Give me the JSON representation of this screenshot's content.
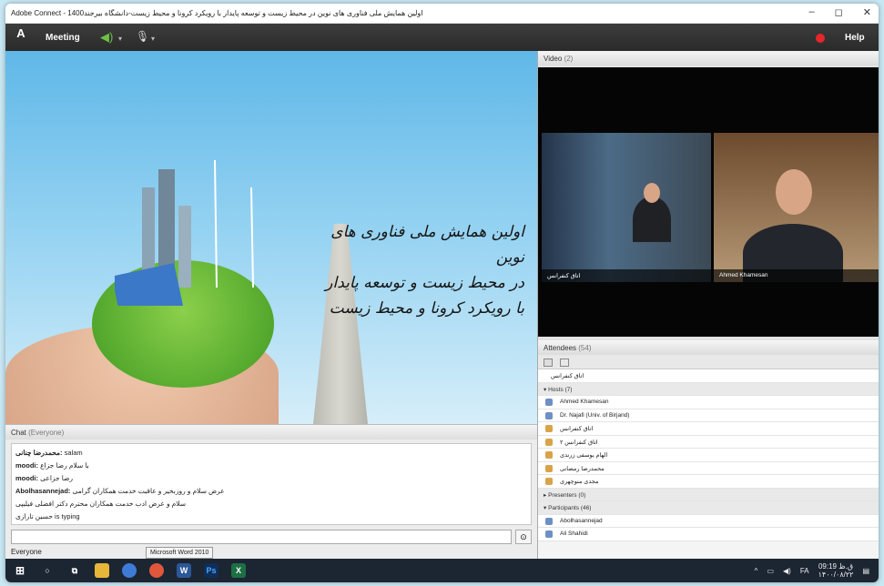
{
  "window": {
    "title": "اولین همایش ملی فناوری های نوین در محیط زیست و توسعه پایدار با رویکرد کرونا و محیط زیست-دانشگاه بیرجند1400 - Adobe Connect",
    "controls": [
      "–",
      "◻",
      "✕"
    ]
  },
  "menubar": {
    "meeting_label": "Meeting",
    "help_label": "Help",
    "logo_text": "A"
  },
  "slide": {
    "title_lines": [
      "اولین همایش ملی فناوری های نوین",
      "در محیط زیست و توسعه پایدار",
      "با رویکرد کرونا و محیط زیست"
    ]
  },
  "chat": {
    "title": "Chat",
    "scope": "(Everyone)",
    "messages": [
      {
        "sender": "محمدرضا چنانی:",
        "text": "salam"
      },
      {
        "sender": "moodi:",
        "text": "با سلام رضا جزاع"
      },
      {
        "sender": "moodi:",
        "text": "رضا جزاعی"
      },
      {
        "sender": "Abolhasannejad:",
        "text": "عرض سلام و روزبخیر و عاقبت خدمت همکاران گرامی"
      },
      {
        "sender": "",
        "text": "سلام و عرض ادب خدمت همکاران محترم دکتر افضلی فیلیپی"
      },
      {
        "sender": "",
        "text": "حسین تارازی is typing"
      }
    ],
    "recipient": "Everyone"
  },
  "video": {
    "title": "Video",
    "count": "(2)",
    "feeds": [
      {
        "name": "اتاق کنفرانس"
      },
      {
        "name": "Ahmed Khamesan"
      }
    ]
  },
  "attendees": {
    "title": "Attendees",
    "count": "(54)",
    "me": "اتاق کنفرانس",
    "hosts_label": "Hosts (7)",
    "hosts": [
      "Ahmed Khamesan",
      "Dr. Najafi (Univ. of Birjand)",
      "اتاق کنفرانس",
      "اتاق کنفرانس ۲",
      "الهام یوسفی زرندی",
      "محمدرضا رمضانی",
      "مجدی منوچهری"
    ],
    "presenters_label": "Presenters (0)",
    "participants_label": "Participants (46)",
    "participants": [
      "Abolhasannejad",
      "Ali Shahidi"
    ]
  },
  "taskbar": {
    "tooltip": "Microsoft Word 2010",
    "time": "09:19 ق.ظ",
    "date": "۱۴۰۰/۰۸/۲۲",
    "lang": "FA"
  },
  "colors": {
    "menubar": "#2f2f2f",
    "slide_sky": "#5fb8e8",
    "recording": "#e8252a"
  }
}
